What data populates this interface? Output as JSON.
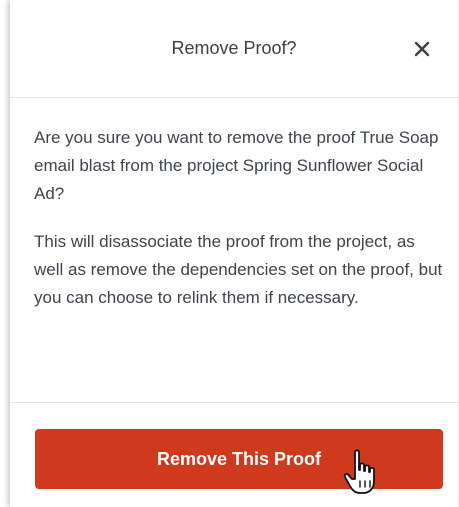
{
  "dialog": {
    "title": "Remove Proof?",
    "close_icon": "close-icon",
    "paragraphs": [
      "Are you sure you want to remove the proof True Soap email blast from the project Spring Sunflower Social Ad?",
      "This will disassociate the proof from the project, as well as remove the dependencies set on the proof, but you can choose to relink them if necessary."
    ],
    "primary_button_label": "Remove This Proof"
  },
  "colors": {
    "primary_button": "#cf3a1f",
    "text": "#3d434c",
    "divider": "#e3e5e8"
  },
  "cursor_icon": "hand-pointer-icon"
}
